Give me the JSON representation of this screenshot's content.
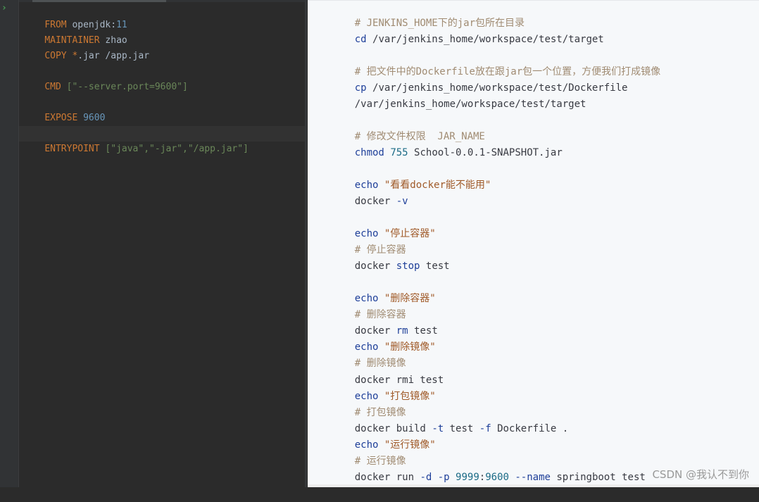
{
  "editor": {
    "run_marker": "›",
    "lines": [
      {
        "kw": "FROM",
        "rest": "openjdk",
        "sep": ":",
        "num": "11"
      },
      {
        "kw": "MAINTAINER",
        "rest": "zhao"
      },
      {
        "kw": "COPY",
        "rest1": "*",
        "rest2": ".jar /app.jar"
      },
      {
        "kw": "CMD",
        "args": "[\"--server.port=9600\"]"
      },
      {
        "kw": "EXPOSE",
        "num": "9600"
      },
      {
        "kw": "ENTRYPOINT",
        "args": "[\"java\",\"-jar\",\"/app.jar\"]"
      }
    ]
  },
  "script": {
    "l01": "# JENKINS_HOME下的jar包所在目录",
    "l02_cmd": "cd",
    "l02_arg": "/var/jenkins_home/workspace/test/target",
    "l03": "# 把文件中的Dockerfile放在跟jar包一个位置，方便我们打成镜像",
    "l04_cmd": "cp",
    "l04_arg": "/var/jenkins_home/workspace/test/Dockerfile",
    "l05": "/var/jenkins_home/workspace/test/target",
    "l06": "# 修改文件权限  JAR_NAME",
    "l07_cmd": "chmod",
    "l07_num": "755",
    "l07_arg": "School-0.0.1-SNAPSHOT.jar",
    "l08_echo": "echo",
    "l08_str": "\"看看docker能不能用\"",
    "l09_cmd": "docker",
    "l09_opt": "-v",
    "l10_echo": "echo",
    "l10_str": "\"停止容器\"",
    "l11": "# 停止容器",
    "l12_cmd": "docker",
    "l12_sub": "stop",
    "l12_arg": "test",
    "l13_echo": "echo",
    "l13_str": "\"删除容器\"",
    "l14": "# 删除容器",
    "l15_cmd": "docker",
    "l15_sub": "rm",
    "l15_arg": "test",
    "l16_echo": "echo",
    "l16_str": "\"删除镜像\"",
    "l17": "# 删除镜像",
    "l18": "docker rmi test",
    "l19_echo": "echo",
    "l19_str": "\"打包镜像\"",
    "l20": "# 打包镜像",
    "l21_a": "docker build",
    "l21_opt1": "-t",
    "l21_b": "test",
    "l21_opt2": "-f",
    "l21_c": "Dockerfile .",
    "l22_echo": "echo",
    "l22_str": "\"运行镜像\"",
    "l23": "# 运行镜像",
    "l24_a": "docker run",
    "l24_opt1": "-d",
    "l24_opt2": "-p",
    "l24_num": "9999",
    "l24_sep": ":",
    "l24_port": "9600",
    "l24_opt3": "--name",
    "l24_b": "springboot test"
  },
  "watermark": "CSDN @我认不到你",
  "colors": {
    "ide_bg": "#2b2b2b",
    "ide_keyword": "#cc7832",
    "ide_string": "#6a8759",
    "ide_number": "#6897bb",
    "ide_text": "#a9b7c6",
    "code_bg": "#f6f8fa",
    "code_comment": "#a08b72",
    "code_string": "#a05a28",
    "code_keyword": "#1e3f99"
  }
}
